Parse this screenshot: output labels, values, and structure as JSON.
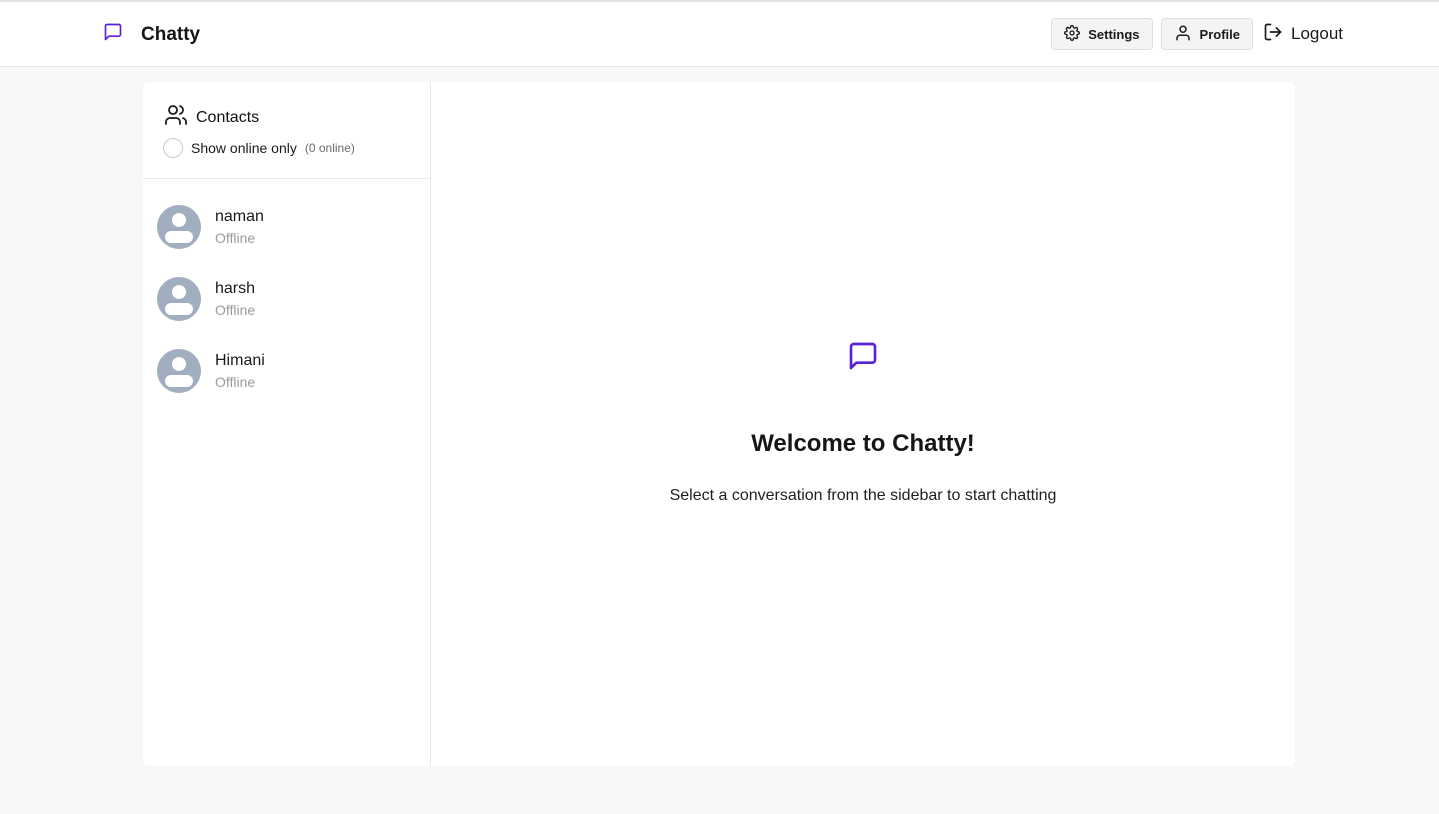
{
  "app": {
    "title": "Chatty",
    "accent_color": "#5b21d6"
  },
  "header": {
    "settings_label": "Settings",
    "profile_label": "Profile",
    "logout_label": "Logout"
  },
  "sidebar": {
    "title": "Contacts",
    "filter_label": "Show online only",
    "online_count": "(0 online)",
    "contacts": [
      {
        "name": "naman",
        "status": "Offline"
      },
      {
        "name": "harsh",
        "status": "Offline"
      },
      {
        "name": "Himani",
        "status": "Offline"
      }
    ]
  },
  "main": {
    "welcome_title": "Welcome to Chatty!",
    "welcome_subtitle": "Select a conversation from the sidebar to start chatting"
  },
  "icons": {
    "brand": "message-square-icon",
    "settings": "gear-icon",
    "profile": "user-icon",
    "logout": "logout-icon",
    "contacts": "users-icon",
    "welcome": "message-square-icon"
  }
}
